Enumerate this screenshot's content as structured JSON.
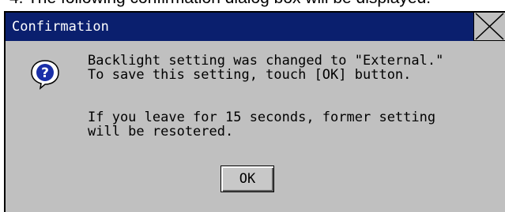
{
  "caption": "4.  The following confirmation dialog box will be displayed.",
  "dialog": {
    "title": "Confirmation",
    "icon": "question-icon",
    "message_line1": "Backlight setting was changed to \"External.\"",
    "message_line2": "To save this setting, touch [OK] button.",
    "message_line3": "If you leave for 15 seconds, former setting",
    "message_line4": "will be resotered.",
    "ok_label": "OK"
  },
  "colors": {
    "titlebar": "#0a1f6e",
    "dialog_bg": "#c0c0c0",
    "icon_blue": "#1a2fa8"
  }
}
